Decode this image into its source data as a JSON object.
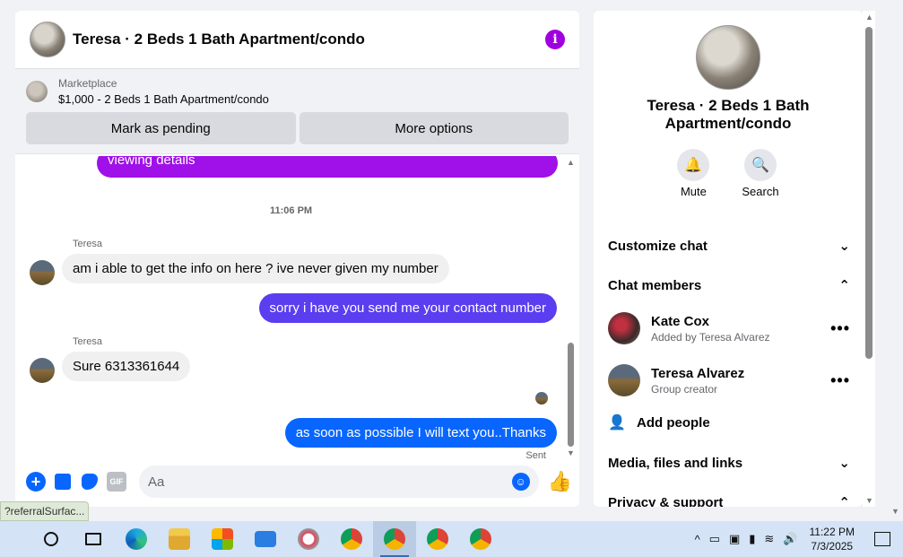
{
  "chat": {
    "title": "Teresa · 2 Beds 1 Bath Apartment/condo",
    "marketplace_label": "Marketplace",
    "listing": "$1,000 - 2 Beds 1 Bath Apartment/condo",
    "buttons": {
      "pending": "Mark as pending",
      "more": "More options"
    },
    "messages": {
      "partial_out": "viewing details",
      "timestamp": "11:06 PM",
      "sender1": "Teresa",
      "in1": "am i able to get the info on here ? ive never given my number",
      "out1": "sorry i have you send me your contact number",
      "sender2": "Teresa",
      "in2": "Sure 6313361644",
      "out2": "as soon as possible I will text you..Thanks",
      "sent": "Sent"
    },
    "input_placeholder": "Aa"
  },
  "url_tip": "?referralSurfac...",
  "right": {
    "title": "Teresa · 2 Beds 1 Bath Apartment/condo",
    "actions": {
      "mute": "Mute",
      "search": "Search"
    },
    "sections": {
      "customize": "Customize chat",
      "members": "Chat members",
      "media": "Media, files and links",
      "privacy": "Privacy & support"
    },
    "members": [
      {
        "name": "Kate Cox",
        "sub": "Added by Teresa Alvarez"
      },
      {
        "name": "Teresa Alvarez",
        "sub": "Group creator"
      }
    ],
    "add_people": "Add people"
  },
  "taskbar": {
    "time": "11:22 PM",
    "date": "7/3/2025"
  },
  "colors": {
    "purple": "#a010e8",
    "violet": "#5a3ef0",
    "blue": "#0866ff"
  }
}
